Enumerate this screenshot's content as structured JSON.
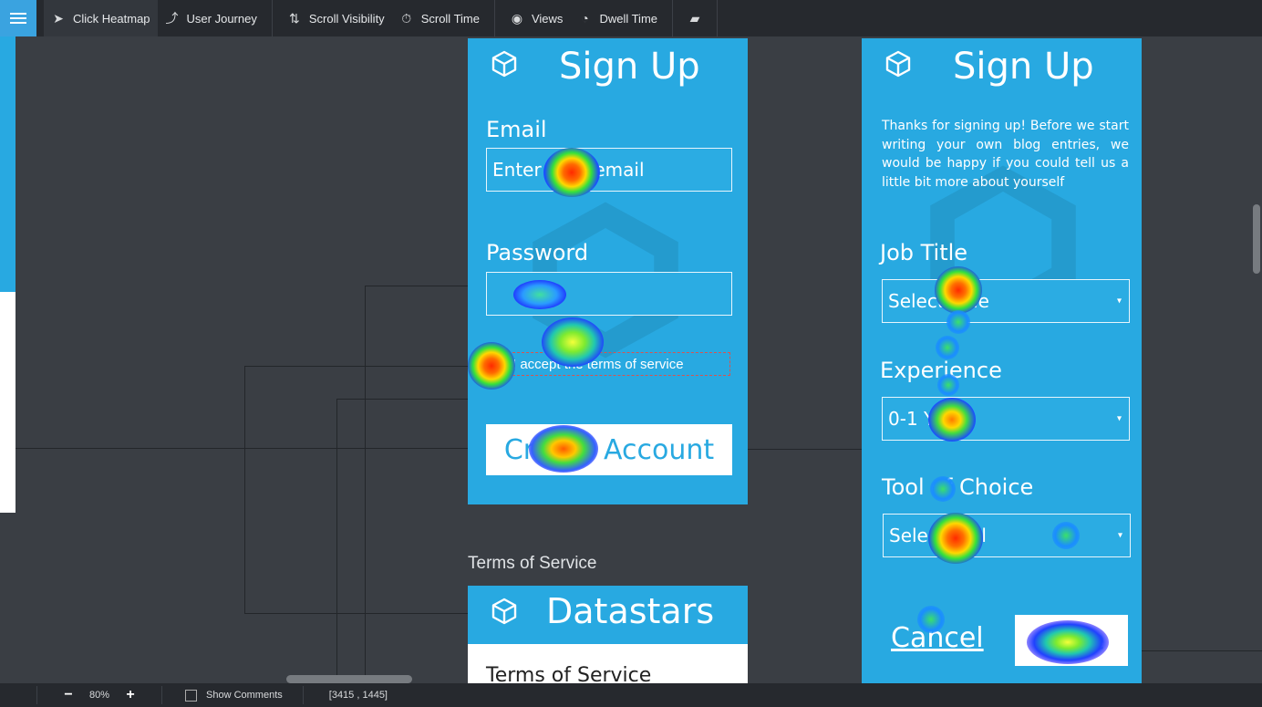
{
  "toolbar": {
    "items": [
      {
        "label": "Click Heatmap",
        "icon": "cursor-icon"
      },
      {
        "label": "User Journey",
        "icon": "journey-icon"
      },
      {
        "label": "Scroll Visibility",
        "icon": "scroll-arrows-icon"
      },
      {
        "label": "Scroll Time",
        "icon": "stopwatch-icon"
      },
      {
        "label": "Views",
        "icon": "eye-icon"
      },
      {
        "label": "Dwell Time",
        "icon": "dwell-icon"
      }
    ]
  },
  "signup_card": {
    "title": "Sign Up",
    "email_label": "Email",
    "email_placeholder": "Enter your email",
    "password_label": "Password",
    "terms_label": "I accept the terms of service",
    "create_button": "Create Account"
  },
  "profile_card": {
    "title": "Sign Up",
    "intro": "Thanks for signing up! Before we start writing your own blog entries, we would be happy if you could tell us a little bit more about yourself",
    "job_label": "Job Title",
    "job_value": "Select Title",
    "experience_label": "Experience",
    "experience_value": "0-1 Years",
    "tool_label": "Tool of Choice",
    "tool_value": "Select Tool",
    "cancel": "Cancel",
    "save": "Save"
  },
  "tos": {
    "caption": "Terms of Service",
    "title": "Datastars",
    "body_heading": "Terms of Service"
  },
  "statusbar": {
    "zoom": "80%",
    "zoom_out": "−",
    "zoom_in": "+",
    "show_comments": "Show Comments",
    "coords": "[3415 , 1445]"
  },
  "colors": {
    "accent": "#28a9e1",
    "toolbar": "#26292e",
    "canvas": "#3a3e44"
  }
}
